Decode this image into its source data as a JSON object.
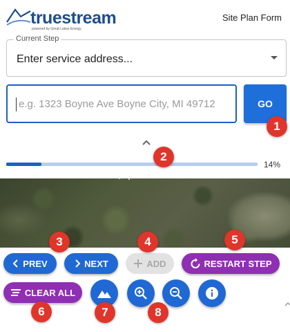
{
  "header": {
    "logo_text": "truestream",
    "logo_tagline": "powered by Great Lakes Energy",
    "form_title": "Site Plan Form"
  },
  "step_selector": {
    "label": "Current Step",
    "value": "Enter service address..."
  },
  "address": {
    "placeholder": "e.g. 1323 Boyne Ave Boyne City, MI 49712",
    "go_label": "GO"
  },
  "progress": {
    "value": 0.14,
    "text": "14%"
  },
  "toolbar": {
    "prev_label": "PREV",
    "next_label": "NEXT",
    "add_label": "ADD",
    "restart_label": "RESTART STEP",
    "clear_label": "CLEAR ALL"
  },
  "annotations": [
    "1",
    "2",
    "3",
    "4",
    "5",
    "6",
    "7",
    "8"
  ],
  "colors": {
    "primary": "#2068d4",
    "secondary": "#8f2fb3",
    "badge": "#e0352b",
    "brand": "#1e4e8c"
  }
}
